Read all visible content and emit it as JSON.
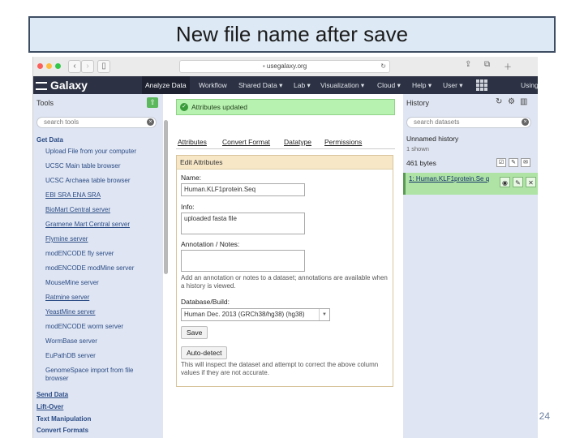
{
  "slide": {
    "title": "New file name after save",
    "page_number": "24"
  },
  "browser": {
    "url": "usegalaxy.org"
  },
  "masthead": {
    "brand": "Galaxy",
    "nav": [
      "Analyze Data",
      "Workflow",
      "Shared Data ▾",
      "Lab ▾",
      "Visualization ▾",
      "Cloud ▾",
      "Help ▾",
      "User ▾"
    ],
    "active_nav": "Analyze Data",
    "overflow_text": "Using"
  },
  "tools_panel": {
    "title": "Tools",
    "search_placeholder": "search tools",
    "sections": [
      {
        "name": "Get Data",
        "tools": [
          "Upload File from your computer",
          "UCSC Main table browser",
          "UCSC Archaea table browser",
          "EBI SRA ENA SRA",
          "BioMart Central server",
          "Gramene Mart Central server",
          "Flymine server",
          "modENCODE fly server",
          "modENCODE modMine server",
          "MouseMine server",
          "Ratmine server",
          "YeastMine server",
          "modENCODE worm server",
          "WormBase server",
          "EuPathDB server",
          "GenomeSpace import from file browser"
        ]
      }
    ],
    "more_sections": [
      "Send Data",
      "Lift-Over",
      "Text Manipulation",
      "Convert Formats"
    ]
  },
  "center": {
    "alert": "Attributes updated",
    "tabs": [
      "Attributes",
      "Convert Format",
      "Datatype",
      "Permissions"
    ],
    "active_tab": "Attributes",
    "form_title": "Edit Attributes",
    "name_label": "Name:",
    "name_value": "Human.KLF1protein.Seq",
    "info_label": "Info:",
    "info_value": "uploaded fasta file",
    "annotation_label": "Annotation / Notes:",
    "annotation_help": "Add an annotation or notes to a dataset; annotations are available when a history is viewed.",
    "build_label": "Database/Build:",
    "build_value": "Human Dec. 2013 (GRCh38/hg38) (hg38)",
    "save_button": "Save",
    "autodetect_button": "Auto-detect",
    "autodetect_help": "This will inspect the dataset and attempt to correct the above column values if they are not accurate."
  },
  "history_panel": {
    "title": "History",
    "search_placeholder": "search datasets",
    "history_name": "Unnamed history",
    "shown": "1 shown",
    "size": "461 bytes",
    "dataset_title": "1: Human.KLF1protein.Se q"
  }
}
